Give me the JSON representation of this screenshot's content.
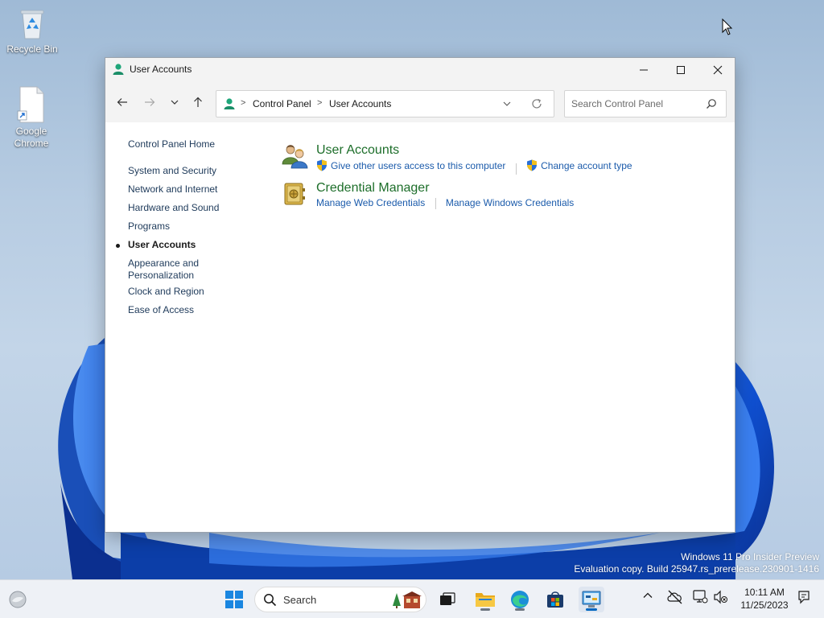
{
  "desktop": {
    "icons": [
      {
        "label": "Recycle Bin",
        "icon": "recycle-bin-icon"
      },
      {
        "label": "Google Chrome",
        "icon": "chrome-shortcut-icon"
      }
    ],
    "watermark": {
      "line1": "Windows 11 Pro Insider Preview",
      "line2": "Evaluation copy. Build 25947.rs_prerelease.230901-1416"
    }
  },
  "window": {
    "title": "User Accounts",
    "controls": {
      "minimize": "minimize-icon",
      "maximize": "maximize-icon",
      "close": "close-icon"
    },
    "address": {
      "crumbs": [
        "Control Panel",
        "User Accounts"
      ],
      "separator": ">"
    },
    "search": {
      "placeholder": "Search Control Panel",
      "value": ""
    }
  },
  "sidebar": {
    "items": [
      {
        "label": "Control Panel Home",
        "active": false
      },
      {
        "label": "System and Security",
        "active": false
      },
      {
        "label": "Network and Internet",
        "active": false
      },
      {
        "label": "Hardware and Sound",
        "active": false
      },
      {
        "label": "Programs",
        "active": false
      },
      {
        "label": "User Accounts",
        "active": true
      },
      {
        "label": "Appearance and Personalization",
        "active": false
      },
      {
        "label": "Clock and Region",
        "active": false
      },
      {
        "label": "Ease of Access",
        "active": false
      }
    ]
  },
  "main": {
    "categories": [
      {
        "title": "User Accounts",
        "icon": "user-accounts-icon",
        "links": [
          "Give other users access to this computer",
          "Change account type"
        ]
      },
      {
        "title": "Credential Manager",
        "icon": "credential-manager-icon",
        "links": [
          "Manage Web Credentials",
          "Manage Windows Credentials"
        ]
      }
    ]
  },
  "taskbar": {
    "search_label": "Search",
    "clock": {
      "time": "10:11 AM",
      "date": "11/25/2023"
    },
    "apps": [
      "start-icon",
      "search-icon",
      "task-view-icon",
      "file-explorer-icon",
      "edge-icon",
      "store-icon",
      "control-panel-icon"
    ],
    "colors": {
      "accent": "#0067c0",
      "link": "#1b5bab",
      "category_title": "#1d6e2a"
    }
  }
}
